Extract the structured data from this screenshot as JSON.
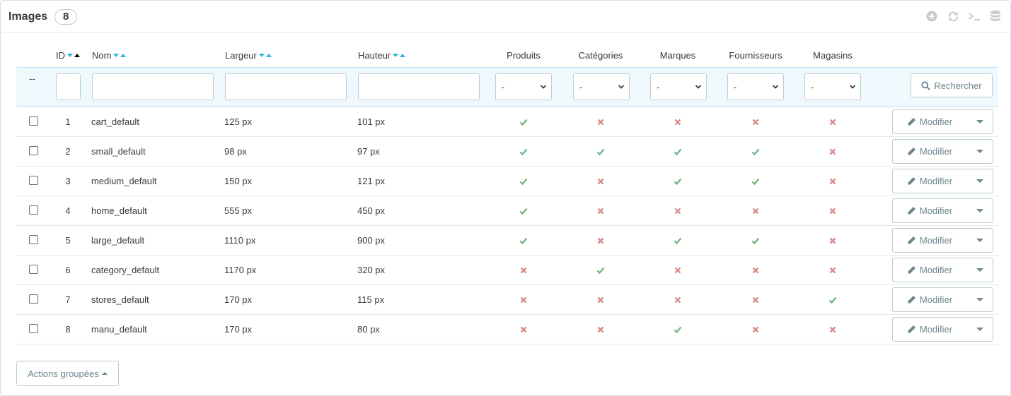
{
  "panel": {
    "title": "Images",
    "count": "8"
  },
  "toolbar": {
    "icons": [
      "add-icon",
      "refresh-icon",
      "sql-terminal-icon",
      "database-icon"
    ]
  },
  "columns": {
    "id": "ID",
    "name": "Nom",
    "width": "Largeur",
    "height": "Hauteur",
    "products": "Produits",
    "categories": "Catégories",
    "brands": "Marques",
    "suppliers": "Fournisseurs",
    "stores": "Magasins"
  },
  "filters": {
    "dashes": "--",
    "select_value": "-",
    "search_label": "Rechercher"
  },
  "colors": {
    "check": "#70b580",
    "cross": "#d98a8a",
    "accent": "#25b9d7"
  },
  "rows": [
    {
      "id": "1",
      "name": "cart_default",
      "width": "125 px",
      "height": "101 px",
      "products": true,
      "categories": false,
      "brands": false,
      "suppliers": false,
      "stores": false
    },
    {
      "id": "2",
      "name": "small_default",
      "width": "98 px",
      "height": "97 px",
      "products": true,
      "categories": true,
      "brands": true,
      "suppliers": true,
      "stores": false
    },
    {
      "id": "3",
      "name": "medium_default",
      "width": "150 px",
      "height": "121 px",
      "products": true,
      "categories": false,
      "brands": true,
      "suppliers": true,
      "stores": false
    },
    {
      "id": "4",
      "name": "home_default",
      "width": "555 px",
      "height": "450 px",
      "products": true,
      "categories": false,
      "brands": false,
      "suppliers": false,
      "stores": false
    },
    {
      "id": "5",
      "name": "large_default",
      "width": "1110 px",
      "height": "900 px",
      "products": true,
      "categories": false,
      "brands": true,
      "suppliers": true,
      "stores": false
    },
    {
      "id": "6",
      "name": "category_default",
      "width": "1170 px",
      "height": "320 px",
      "products": false,
      "categories": true,
      "brands": false,
      "suppliers": false,
      "stores": false
    },
    {
      "id": "7",
      "name": "stores_default",
      "width": "170 px",
      "height": "115 px",
      "products": false,
      "categories": false,
      "brands": false,
      "suppliers": false,
      "stores": true
    },
    {
      "id": "8",
      "name": "manu_default",
      "width": "170 px",
      "height": "80 px",
      "products": false,
      "categories": false,
      "brands": true,
      "suppliers": false,
      "stores": false
    }
  ],
  "row_action": {
    "edit_label": "Modifier"
  },
  "bulk": {
    "label": "Actions groupées"
  }
}
